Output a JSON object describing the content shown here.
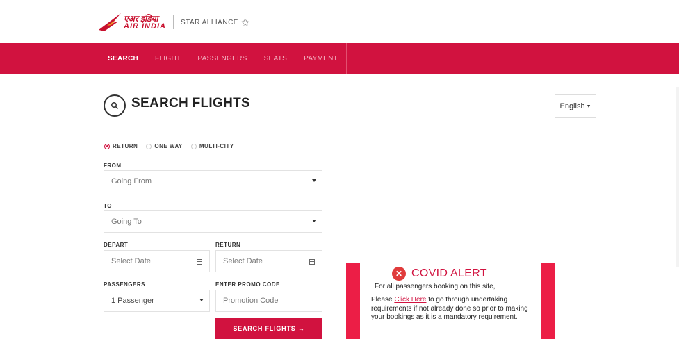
{
  "brand": {
    "logo_hindi": "एअर इंडिया",
    "logo_english": "AIR INDIA",
    "alliance": "STAR ALLIANCE",
    "accent_color": "#d1123f"
  },
  "nav": {
    "items": [
      {
        "label": "SEARCH",
        "active": true
      },
      {
        "label": "FLIGHT",
        "active": false
      },
      {
        "label": "PASSENGERS",
        "active": false
      },
      {
        "label": "SEATS",
        "active": false
      },
      {
        "label": "PAYMENT",
        "active": false
      }
    ]
  },
  "page": {
    "title": "SEARCH FLIGHTS",
    "language": "English"
  },
  "trip_type": {
    "options": [
      {
        "label": "RETURN",
        "selected": true
      },
      {
        "label": "ONE WAY",
        "selected": false
      },
      {
        "label": "MULTI-CITY",
        "selected": false
      }
    ]
  },
  "form": {
    "from_label": "FROM",
    "from_placeholder": "Going From",
    "to_label": "TO",
    "to_placeholder": "Going To",
    "depart_label": "DEPART",
    "depart_placeholder": "Select Date",
    "return_label": "RETURN",
    "return_placeholder": "Select Date",
    "passengers_label": "PASSENGERS",
    "passengers_value": "1 Passenger",
    "promo_label": "ENTER PROMO CODE",
    "promo_placeholder": "Promotion Code",
    "submit_label": "SEARCH FLIGHTS →"
  },
  "covid": {
    "title": "COVID ALERT",
    "line1": "For all passengers booking on this site,",
    "body_prefix": "Please ",
    "link_text": "Click Here",
    "body_suffix": " to go through undertaking requirements if not already done so prior to making your bookings as it is a mandatory requirement."
  }
}
